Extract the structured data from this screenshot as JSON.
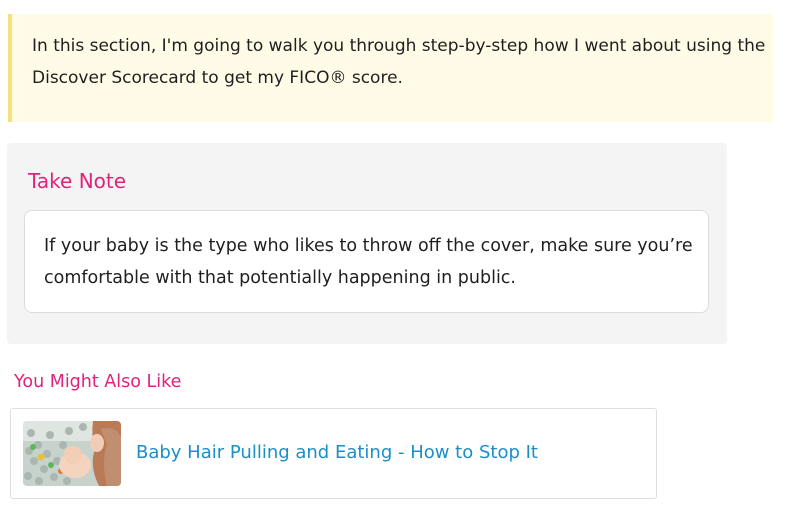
{
  "callout": {
    "text": "In this section, I'm going to walk you through step-by-step how I went about using the Discover Scorecard to get my FICO® score."
  },
  "take_note": {
    "title": "Take Note",
    "body": "If your baby is the type who likes to throw off the cover, make sure you’re comfortable with that potentially happening in public."
  },
  "related": {
    "heading": "You Might Also Like",
    "items": [
      {
        "title": "Baby Hair Pulling and Eating - How to Stop It",
        "thumbnail": "baby-playing-thumbnail"
      }
    ]
  },
  "colors": {
    "accent_pink": "#e0237a",
    "link_blue": "#1b8ec9",
    "callout_bg": "#fffbe6",
    "callout_border": "#f7e27a",
    "note_bg": "#f4f4f4"
  }
}
